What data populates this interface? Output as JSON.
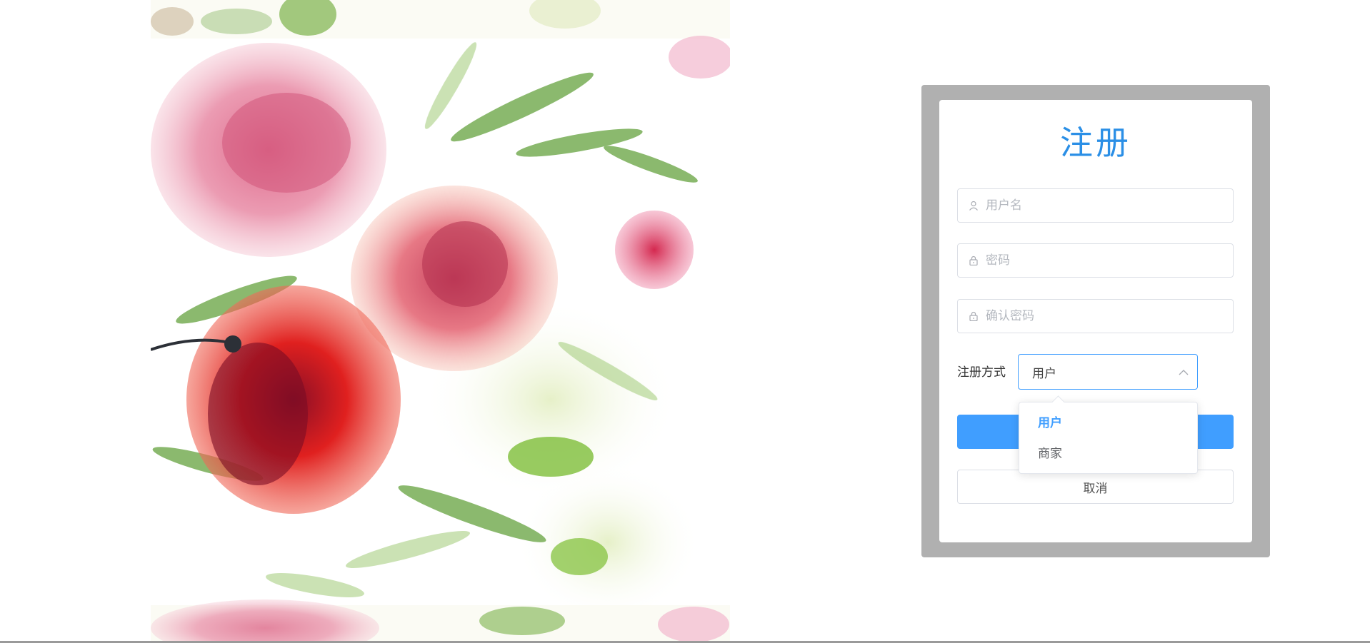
{
  "register": {
    "title": "注册",
    "username_placeholder": "用户名",
    "password_placeholder": "密码",
    "confirm_placeholder": "确认密码",
    "mode_label": "注册方式",
    "mode_selected": "用户",
    "mode_options": [
      "用户",
      "商家"
    ],
    "submit_label": "",
    "cancel_label": "取消"
  },
  "icons": {
    "username": "user-icon",
    "password": "lock-icon",
    "confirm": "lock-icon",
    "select_arrow": "chevron-up-icon"
  },
  "colors": {
    "accent": "#409eff",
    "title": "#2b8fe6",
    "frame": "#b0b0b0"
  }
}
